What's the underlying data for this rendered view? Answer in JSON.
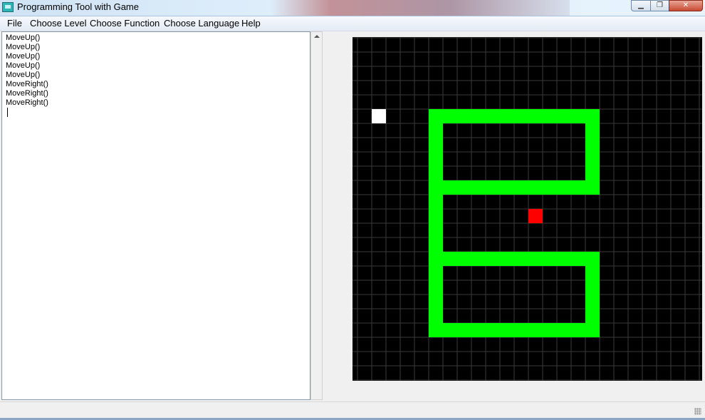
{
  "window": {
    "title": "Programming Tool with Game",
    "controls": [
      "minimize-icon",
      "maximize-icon",
      "close-icon"
    ]
  },
  "menu": [
    "File",
    "Choose Level",
    "Choose Function",
    "Choose Language",
    "Help"
  ],
  "editor": {
    "lines": [
      "MoveUp()",
      "MoveUp()",
      "MoveUp()",
      "MoveUp()",
      "MoveUp()",
      "MoveRight()",
      "MoveRight()",
      "MoveRight()"
    ]
  },
  "game": {
    "background": "#000000",
    "grid_color": "#3a3a3a",
    "wall_color": "#00ff00",
    "player_color": "#ffffff",
    "target_color": "#ff0000"
  }
}
